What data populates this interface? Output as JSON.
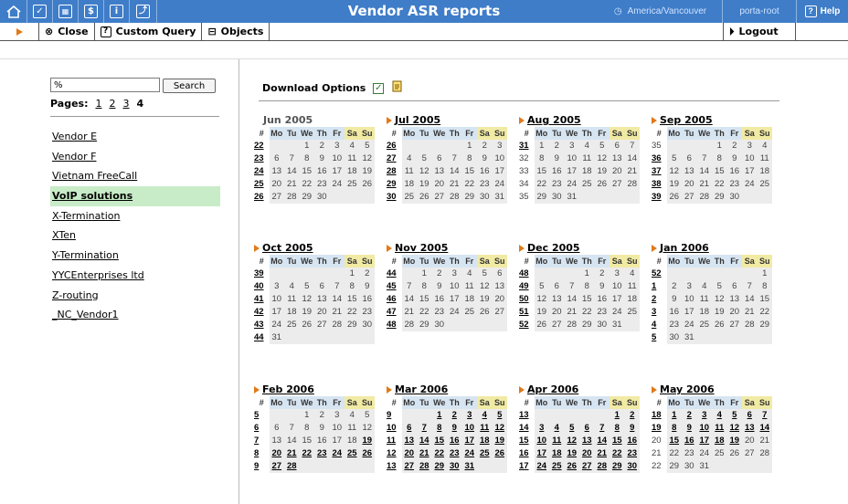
{
  "header": {
    "title": "Vendor ASR reports",
    "timezone": "America/Vancouver",
    "user": "porta-root",
    "help_label": "Help"
  },
  "toolbar": {
    "close_label": "Close",
    "custom_query_label": "Custom Query",
    "objects_label": "Objects",
    "logout_label": "Logout"
  },
  "search": {
    "value": "%",
    "button_label": "Search"
  },
  "pagination": {
    "label": "Pages:",
    "pages": [
      "1",
      "2",
      "3",
      "4"
    ],
    "current": "4"
  },
  "vendors": [
    "Vendor E",
    "Vendor F",
    "Vietnam FreeCall",
    "VoIP solutions",
    "X-Termination",
    "XTen",
    "Y-Termination",
    "YYCEnterprises ltd",
    "Z-routing",
    "_NC_Vendor1"
  ],
  "selected_vendor": "VoIP solutions",
  "download": {
    "label": "Download Options"
  },
  "day_headers": [
    "#",
    "Mo",
    "Tu",
    "We",
    "Th",
    "Fr",
    "Sa",
    "Su"
  ],
  "calendars": [
    {
      "title": "Jun 2005",
      "linked": false,
      "weeks": [
        [
          "22",
          "",
          "",
          "1",
          "2",
          "3",
          "4",
          "5"
        ],
        [
          "23",
          "6",
          "7",
          "8",
          "9",
          "10",
          "11",
          "12"
        ],
        [
          "24",
          "13",
          "14",
          "15",
          "16",
          "17",
          "18",
          "19"
        ],
        [
          "25",
          "20",
          "21",
          "22",
          "23",
          "24",
          "25",
          "26"
        ],
        [
          "26",
          "27",
          "28",
          "29",
          "30",
          "",
          "",
          ""
        ]
      ]
    },
    {
      "title": "Jul 2005",
      "linked": true,
      "weeks": [
        [
          "26",
          "",
          "",
          "",
          "",
          "1",
          "2",
          "3"
        ],
        [
          "27",
          "4",
          "5",
          "6",
          "7",
          "8",
          "9",
          "10"
        ],
        [
          "28",
          "11",
          "12",
          "13",
          "14",
          "15",
          "16",
          "17"
        ],
        [
          "29",
          "18",
          "19",
          "20",
          "21",
          "22",
          "23",
          "24"
        ],
        [
          "30",
          "25",
          "26",
          "27",
          "28",
          "29",
          "30",
          "31"
        ]
      ]
    },
    {
      "title": "Aug 2005",
      "linked": true,
      "weeks": [
        [
          "31",
          "1",
          "2",
          "3",
          "4",
          "5",
          "6",
          "7"
        ],
        [
          "32",
          "8",
          "9",
          "10",
          "11",
          "12",
          "13",
          "14"
        ],
        [
          "33",
          "15",
          "16",
          "17",
          "18",
          "19",
          "20",
          "21"
        ],
        [
          "34",
          "22",
          "23",
          "24",
          "25",
          "26",
          "27",
          "28"
        ],
        [
          "35",
          "29",
          "30",
          "31",
          "",
          "",
          "",
          ""
        ]
      ]
    },
    {
      "title": "Sep 2005",
      "linked": true,
      "weeks": [
        [
          "35",
          "",
          "",
          "",
          "1",
          "2",
          "3",
          "4"
        ],
        [
          "36",
          "5",
          "6",
          "7",
          "8",
          "9",
          "10",
          "11"
        ],
        [
          "37",
          "12",
          "13",
          "14",
          "15",
          "16",
          "17",
          "18"
        ],
        [
          "38",
          "19",
          "20",
          "21",
          "22",
          "23",
          "24",
          "25"
        ],
        [
          "39",
          "26",
          "27",
          "28",
          "29",
          "30",
          "",
          ""
        ]
      ]
    },
    {
      "title": "Oct 2005",
      "linked": true,
      "weeks": [
        [
          "39",
          "",
          "",
          "",
          "",
          "",
          "1",
          "2"
        ],
        [
          "40",
          "3",
          "4",
          "5",
          "6",
          "7",
          "8",
          "9"
        ],
        [
          "41",
          "10",
          "11",
          "12",
          "13",
          "14",
          "15",
          "16"
        ],
        [
          "42",
          "17",
          "18",
          "19",
          "20",
          "21",
          "22",
          "23"
        ],
        [
          "43",
          "24",
          "25",
          "26",
          "27",
          "28",
          "29",
          "30"
        ],
        [
          "44",
          "31",
          "",
          "",
          "",
          "",
          "",
          ""
        ]
      ]
    },
    {
      "title": "Nov 2005",
      "linked": true,
      "weeks": [
        [
          "44",
          "",
          "1",
          "2",
          "3",
          "4",
          "5",
          "6"
        ],
        [
          "45",
          "7",
          "8",
          "9",
          "10",
          "11",
          "12",
          "13"
        ],
        [
          "46",
          "14",
          "15",
          "16",
          "17",
          "18",
          "19",
          "20"
        ],
        [
          "47",
          "21",
          "22",
          "23",
          "24",
          "25",
          "26",
          "27"
        ],
        [
          "48",
          "28",
          "29",
          "30",
          "",
          "",
          "",
          ""
        ]
      ]
    },
    {
      "title": "Dec 2005",
      "linked": true,
      "weeks": [
        [
          "48",
          "",
          "",
          "",
          "1",
          "2",
          "3",
          "4"
        ],
        [
          "49",
          "5",
          "6",
          "7",
          "8",
          "9",
          "10",
          "11"
        ],
        [
          "50",
          "12",
          "13",
          "14",
          "15",
          "16",
          "17",
          "18"
        ],
        [
          "51",
          "19",
          "20",
          "21",
          "22",
          "23",
          "24",
          "25"
        ],
        [
          "52",
          "26",
          "27",
          "28",
          "29",
          "30",
          "31",
          ""
        ]
      ]
    },
    {
      "title": "Jan 2006",
      "linked": true,
      "weeks": [
        [
          "52",
          "",
          "",
          "",
          "",
          "",
          "",
          "1"
        ],
        [
          "1",
          "2",
          "3",
          "4",
          "5",
          "6",
          "7",
          "8"
        ],
        [
          "2",
          "9",
          "10",
          "11",
          "12",
          "13",
          "14",
          "15"
        ],
        [
          "3",
          "16",
          "17",
          "18",
          "19",
          "20",
          "21",
          "22"
        ],
        [
          "4",
          "23",
          "24",
          "25",
          "26",
          "27",
          "28",
          "29"
        ],
        [
          "5",
          "30",
          "31",
          "",
          "",
          "",
          "",
          ""
        ]
      ]
    },
    {
      "title": "Feb 2006",
      "linked": true,
      "weeks": [
        [
          "5",
          "",
          "",
          "1",
          "2",
          "3",
          "4",
          "5"
        ],
        [
          "6",
          "6",
          "7",
          "8",
          "9",
          "10",
          "11",
          "12"
        ],
        [
          "7",
          "13",
          "14",
          "15",
          "16",
          "17",
          "18",
          "19"
        ],
        [
          "8",
          "20",
          "21",
          "22",
          "23",
          "24",
          "25",
          "26"
        ],
        [
          "9",
          "27",
          "28",
          "",
          "",
          "",
          "",
          ""
        ]
      ]
    },
    {
      "title": "Mar 2006",
      "linked": true,
      "weeks": [
        [
          "9",
          "",
          "",
          "1",
          "2",
          "3",
          "4",
          "5"
        ],
        [
          "10",
          "6",
          "7",
          "8",
          "9",
          "10",
          "11",
          "12"
        ],
        [
          "11",
          "13",
          "14",
          "15",
          "16",
          "17",
          "18",
          "19"
        ],
        [
          "12",
          "20",
          "21",
          "22",
          "23",
          "24",
          "25",
          "26"
        ],
        [
          "13",
          "27",
          "28",
          "29",
          "30",
          "31",
          "",
          ""
        ]
      ]
    },
    {
      "title": "Apr 2006",
      "linked": true,
      "weeks": [
        [
          "13",
          "",
          "",
          "",
          "",
          "",
          "1",
          "2"
        ],
        [
          "14",
          "3",
          "4",
          "5",
          "6",
          "7",
          "8",
          "9"
        ],
        [
          "15",
          "10",
          "11",
          "12",
          "13",
          "14",
          "15",
          "16"
        ],
        [
          "16",
          "17",
          "18",
          "19",
          "20",
          "21",
          "22",
          "23"
        ],
        [
          "17",
          "24",
          "25",
          "26",
          "27",
          "28",
          "29",
          "30"
        ]
      ]
    },
    {
      "title": "May 2006",
      "linked": true,
      "weeks": [
        [
          "18",
          "1",
          "2",
          "3",
          "4",
          "5",
          "6",
          "7"
        ],
        [
          "19",
          "8",
          "9",
          "10",
          "11",
          "12",
          "13",
          "14"
        ],
        [
          "20",
          "15",
          "16",
          "17",
          "18",
          "19",
          "20",
          "21"
        ],
        [
          "21",
          "22",
          "23",
          "24",
          "25",
          "26",
          "27",
          "28"
        ],
        [
          "22",
          "29",
          "30",
          "31",
          "",
          "",
          "",
          ""
        ]
      ]
    }
  ],
  "linked_weeks": {
    "Jun 2005": [
      "22",
      "23",
      "24",
      "25",
      "26"
    ],
    "Jul 2005": [
      "26",
      "27",
      "28",
      "29",
      "30"
    ],
    "Aug 2005": [
      "31"
    ],
    "Sep 2005": [
      "36",
      "37",
      "38",
      "39"
    ],
    "Oct 2005": [
      "39",
      "40",
      "41",
      "42",
      "43",
      "44"
    ],
    "Nov 2005": [
      "44",
      "45",
      "46",
      "47",
      "48"
    ],
    "Dec 2005": [
      "48",
      "49",
      "50",
      "51",
      "52"
    ],
    "Jan 2006": [
      "52",
      "1",
      "2",
      "3",
      "4",
      "5"
    ],
    "Feb 2006": [
      "5",
      "6",
      "7",
      "8",
      "9"
    ],
    "Mar 2006": [
      "9",
      "10",
      "11",
      "12",
      "13"
    ],
    "Apr 2006": [
      "13",
      "14",
      "15",
      "16",
      "17"
    ],
    "May 2006": [
      "18",
      "19"
    ]
  },
  "linked_days": {
    "Feb 2006": [
      "19",
      "20",
      "21",
      "22",
      "23",
      "24",
      "25",
      "26",
      "27",
      "28"
    ],
    "Mar 2006": [
      "1",
      "2",
      "3",
      "4",
      "5",
      "6",
      "7",
      "8",
      "9",
      "10",
      "11",
      "12",
      "13",
      "14",
      "15",
      "16",
      "17",
      "18",
      "19",
      "20",
      "21",
      "22",
      "23",
      "24",
      "25",
      "26",
      "27",
      "28",
      "29",
      "30",
      "31"
    ],
    "Apr 2006": [
      "1",
      "2",
      "3",
      "4",
      "5",
      "6",
      "7",
      "8",
      "9",
      "10",
      "11",
      "12",
      "13",
      "14",
      "15",
      "16",
      "17",
      "18",
      "19",
      "20",
      "21",
      "22",
      "23",
      "24",
      "25",
      "26",
      "27",
      "28",
      "29",
      "30"
    ],
    "May 2006": [
      "1",
      "2",
      "3",
      "4",
      "5",
      "6",
      "7",
      "8",
      "9",
      "10",
      "11",
      "12",
      "13",
      "14",
      "15",
      "16",
      "17",
      "18",
      "19"
    ]
  },
  "colors": {
    "header_bg": "#3f7dc8",
    "selected_row": "#c8ecc8",
    "weekday_header": "#d7e5f2",
    "weekend_header": "#f1eaa4",
    "arrow": "#e07a1a"
  }
}
